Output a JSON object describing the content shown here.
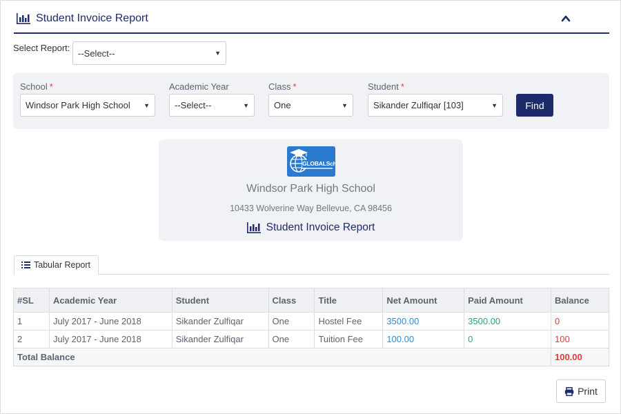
{
  "header": {
    "title": "Student Invoice Report"
  },
  "select_report": {
    "label": "Select Report:",
    "value": "--Select--"
  },
  "filters": {
    "school": {
      "label": "School",
      "required": "*",
      "value": "Windsor Park High School"
    },
    "academic_year": {
      "label": "Academic Year",
      "value": "--Select--"
    },
    "class": {
      "label": "Class",
      "required": "*",
      "value": "One"
    },
    "student": {
      "label": "Student",
      "required": "*",
      "value": "Sikander Zulfiqar [103]"
    },
    "find_label": "Find"
  },
  "report_card": {
    "logo_text_1": "GLOBAL",
    "logo_text_2": "School",
    "school_name": "Windsor Park High School",
    "address": "10433 Wolverine Way Bellevue, CA 98456",
    "title": "Student Invoice Report"
  },
  "tabs": [
    {
      "label": "Tabular Report"
    }
  ],
  "table": {
    "headers": [
      "#SL",
      "Academic Year",
      "Student",
      "Class",
      "Title",
      "Net Amount",
      "Paid Amount",
      "Balance"
    ],
    "rows": [
      {
        "sl": "1",
        "year": "July 2017 - June 2018",
        "student": "Sikander Zulfiqar",
        "class": "One",
        "title": "Hostel Fee",
        "net": "3500.00",
        "paid": "3500.00",
        "balance": "0"
      },
      {
        "sl": "2",
        "year": "July 2017 - June 2018",
        "student": "Sikander Zulfiqar",
        "class": "One",
        "title": "Tuition Fee",
        "net": "100.00",
        "paid": "0",
        "balance": "100"
      }
    ],
    "total_label": "Total Balance",
    "total_value": "100.00"
  },
  "print_label": "Print",
  "colors": {
    "primary": "#1d2b6b",
    "net": "#2a8fd6",
    "paid": "#21a68a",
    "balance": "#e53935"
  }
}
